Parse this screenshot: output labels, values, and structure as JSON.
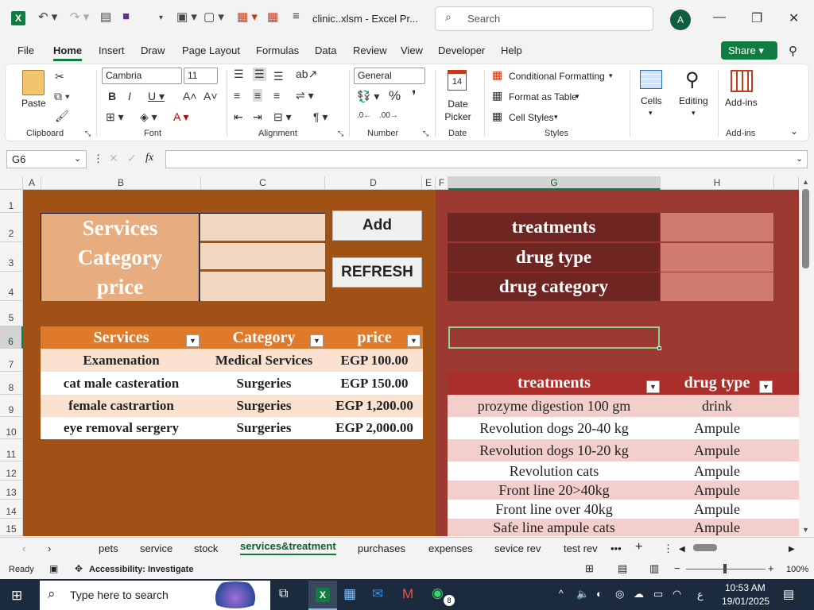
{
  "window": {
    "title": "clinic..xlsm - Excel Pr...",
    "search_placeholder": "Search",
    "avatar": "A"
  },
  "menu": [
    "File",
    "Home",
    "Insert",
    "Draw",
    "Page Layout",
    "Formulas",
    "Data",
    "Review",
    "View",
    "Developer",
    "Help"
  ],
  "share_label": "Share",
  "ribbon": {
    "paste": "Paste",
    "clipboard": "Clipboard",
    "font_name": "Cambria",
    "font_size": "11",
    "font_group": "Font",
    "alignment": "Alignment",
    "number_format": "General",
    "number_group": "Number",
    "date_picker": "Date Picker",
    "date_group": "Date",
    "date_num": "14",
    "cond_format": "Conditional Formatting",
    "format_table": "Format as Table",
    "cell_styles": "Cell Styles",
    "styles_group": "Styles",
    "cells": "Cells",
    "editing": "Editing",
    "addins": "Add-ins",
    "addins_group": "Add-ins"
  },
  "formula_bar": {
    "name_box": "G6",
    "fx": "fx",
    "value": ""
  },
  "columns": [
    "A",
    "B",
    "C",
    "D",
    "E",
    "F",
    "G",
    "H"
  ],
  "rows": [
    "1",
    "2",
    "3",
    "4",
    "5",
    "6",
    "7",
    "8",
    "9",
    "10",
    "11",
    "12",
    "13",
    "14",
    "15"
  ],
  "form_left": {
    "labels": [
      "Services",
      "Category",
      "price"
    ],
    "add_button": "Add",
    "refresh_button": "REFRESH"
  },
  "services_table": {
    "headers": [
      "Services",
      "Category",
      "price"
    ],
    "rows": [
      [
        "Examenation",
        "Medical Services",
        "EGP 100.00"
      ],
      [
        "cat male casteration",
        "Surgeries",
        "EGP 150.00"
      ],
      [
        "female castrartion",
        "Surgeries",
        "EGP 1,200.00"
      ],
      [
        "eye removal sergery",
        "Surgeries",
        "EGP 2,000.00"
      ]
    ]
  },
  "form_right": {
    "labels": [
      "treatments",
      "drug type",
      "drug category"
    ]
  },
  "treatments_table": {
    "headers": [
      "treatments",
      "drug type"
    ],
    "rows": [
      [
        "prozyme digestion 100 gm",
        "drink"
      ],
      [
        "Revolution dogs 20-40 kg",
        "Ampule"
      ],
      [
        "Revolution dogs 10-20 kg",
        "Ampule"
      ],
      [
        "Revolution cats",
        "Ampule"
      ],
      [
        "Front line 20>40kg",
        "Ampule"
      ],
      [
        "Front line over 40kg",
        "Ampule"
      ],
      [
        "Safe line ampule cats",
        "Ampule"
      ]
    ]
  },
  "sheet_tabs": [
    "pets",
    "service",
    "stock",
    "services&treatment",
    "purchases",
    "expenses",
    "sevice rev",
    "test rev"
  ],
  "status": {
    "ready": "Ready",
    "accessibility": "Accessibility: Investigate",
    "zoom": "100%"
  },
  "taskbar": {
    "search": "Type here to search",
    "time": "10:53 AM",
    "date": "19/01/2025",
    "badge": "8",
    "lang": "ع"
  },
  "colors": {
    "excel_green": "#107c41",
    "brown": "#9f5116",
    "dark_red": "#9c3a32",
    "peach": "#e8ad7f"
  }
}
